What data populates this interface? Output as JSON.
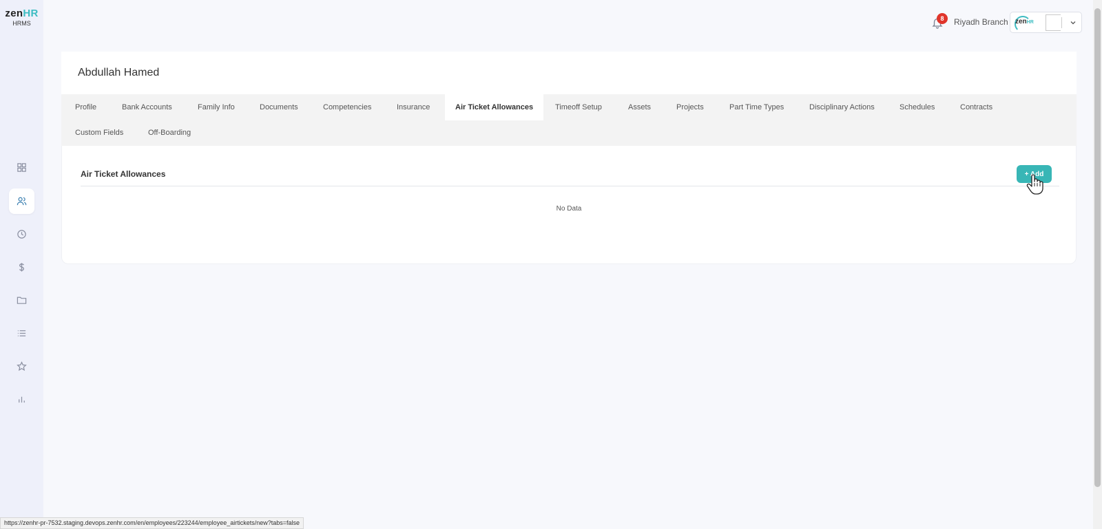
{
  "logo": {
    "word_zen": "zen",
    "word_hr": "HR",
    "subtitle": "HRMS"
  },
  "sidebar": {
    "items": [
      {
        "icon": "dashboard-icon",
        "active": false
      },
      {
        "icon": "users-icon",
        "active": true
      },
      {
        "icon": "clock-icon",
        "active": false
      },
      {
        "icon": "dollar-icon",
        "active": false
      },
      {
        "icon": "folder-icon",
        "active": false
      },
      {
        "icon": "list-icon",
        "active": false
      },
      {
        "icon": "star-icon",
        "active": false
      },
      {
        "icon": "bar-chart-icon",
        "active": false
      }
    ]
  },
  "header": {
    "notification_count": "8",
    "branch": "Riyadh Branch",
    "account_logo_zen": "zen",
    "account_logo_hr": "HR"
  },
  "employee": {
    "name": "Abdullah Hamed"
  },
  "tabs": [
    {
      "label": "Profile",
      "active": false
    },
    {
      "label": "Bank Accounts",
      "active": false
    },
    {
      "label": "Family Info",
      "active": false
    },
    {
      "label": "Documents",
      "active": false
    },
    {
      "label": "Competencies",
      "active": false
    },
    {
      "label": "Insurance",
      "active": false
    },
    {
      "label": "Air Ticket Allowances",
      "active": true
    },
    {
      "label": "Timeoff Setup",
      "active": false
    },
    {
      "label": "Assets",
      "active": false
    },
    {
      "label": "Projects",
      "active": false
    },
    {
      "label": "Part Time Types",
      "active": false
    },
    {
      "label": "Disciplinary Actions",
      "active": false
    },
    {
      "label": "Schedules",
      "active": false
    },
    {
      "label": "Contracts",
      "active": false
    },
    {
      "label": "Custom Fields",
      "active": false
    },
    {
      "label": "Off-Boarding",
      "active": false
    }
  ],
  "section": {
    "title": "Air Ticket Allowances",
    "add_label": "+ Add",
    "empty_text": "No Data"
  },
  "status_bar": {
    "url": "https://zenhr-pr-7532.staging.devops.zenhr.com/en/employees/223244/employee_airtickets/new?tabs=false"
  },
  "colors": {
    "accent": "#38b6b6",
    "badge": "#e0352b",
    "brand_hr": "#3cbcc2"
  }
}
